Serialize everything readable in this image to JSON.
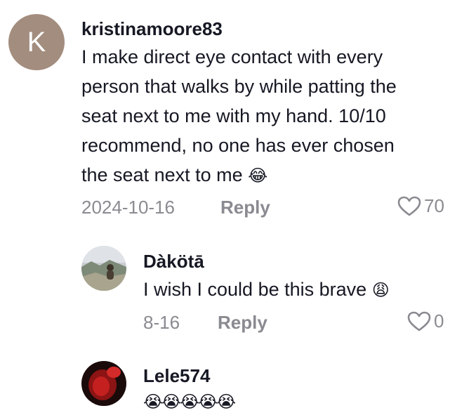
{
  "comment": {
    "avatar_letter": "K",
    "username": "kristinamoore83",
    "lines": [
      "I make direct eye contact with every",
      "person that walks by while patting the",
      "seat next to me with my hand. 10/10",
      "recommend, no one has ever chosen",
      "the seat next to me"
    ],
    "emoji": "😂",
    "date": "2024-10-16",
    "reply_label": "Reply",
    "like_count": "70"
  },
  "replies": [
    {
      "username": "Dàkötā",
      "text": "I wish I could be this brave",
      "emoji": "😩",
      "date": "8-16",
      "reply_label": "Reply",
      "like_count": "0"
    },
    {
      "username": "Lele574",
      "emoji": "😭😭😭😭😭"
    }
  ],
  "colors": {
    "avatar_bg": "#a38d7e",
    "secondary_text": "#8a8b91",
    "primary_text": "#161823"
  }
}
